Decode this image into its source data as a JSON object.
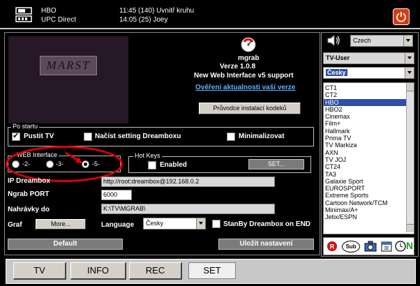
{
  "topbar": {
    "current_channel": "HBO",
    "current_program": "11:45 (140) Uvnitř kruhu",
    "provider": "UPC Direct",
    "next_program": "14:05 (25) Joey"
  },
  "player": {
    "logo_text": "MARST"
  },
  "app": {
    "name": "mgrab",
    "version": "Verze 1.0.8",
    "subtitle": "New Web Interface v5  support",
    "update_link": "Ověření aktualnosti vaší verze",
    "codec_button": "Průvodce instalací kodeků"
  },
  "startup": {
    "group_label": "Po startu",
    "options": [
      {
        "label": "Pustit TV",
        "checked": true
      },
      {
        "label": "Načíst setting Dreamboxu",
        "checked": false
      },
      {
        "label": "Minimalizovat",
        "checked": false
      }
    ]
  },
  "web_interface": {
    "group_label": "WEB Interface",
    "options": [
      {
        "label": "-2-",
        "selected": false
      },
      {
        "label": "-3-",
        "selected": false
      },
      {
        "label": "-5-",
        "selected": true
      }
    ]
  },
  "hotkeys": {
    "group_label": "Hot Keys",
    "enabled_label": "Enabled",
    "enabled": false,
    "set_button": "SET..."
  },
  "settings": {
    "ip_label": "IP Dreambox",
    "ip_value": "http://root:dreambox@192.168.0.2",
    "port_label": "Ngrab PORT",
    "port_value": "6000",
    "recordings_label": "Nahrávky do",
    "recordings_value": "K:\\TV\\MGRAB\\",
    "graph_label": "Graf",
    "more_button": "More...",
    "language_label": "Language",
    "language_value": "Česky",
    "standby_label": "StanBy Dreambox on END",
    "standby_checked": false
  },
  "buttons": {
    "default": "Default",
    "save": "Uložit nastavení"
  },
  "right": {
    "language": "Czech",
    "bouquet": "TV-User",
    "list_lang": "Česky",
    "channels": [
      "CT1",
      "CT2",
      "HBO",
      "HBO2",
      "Cinemax",
      "Film+",
      "Hallmark",
      "Prima TV",
      "TV Markiza",
      "AXN",
      "TV JOJ",
      "CT24",
      "TA3",
      "Galaxie Sport",
      "EUROSPORT",
      "Extreme Sports",
      "Cartoon Network/TCM",
      "Minimax/A+",
      "Jetix/ESPN"
    ],
    "selected_channel": "HBO",
    "icons": [
      "record-icon",
      "subtitle-icon",
      "camera-icon",
      "calendar-icon",
      "clock-icon",
      "n-icon"
    ],
    "icon_sub_label": "Sub",
    "icon_n_label": "N"
  },
  "tabs": [
    {
      "label": "TV",
      "active": false
    },
    {
      "label": "INFO",
      "active": false
    },
    {
      "label": "REC",
      "active": false
    },
    {
      "label": "SET",
      "active": true
    }
  ],
  "colors": {
    "accent": "#e00000",
    "selection": "#2d4fa8",
    "link": "#5ab4ff"
  }
}
